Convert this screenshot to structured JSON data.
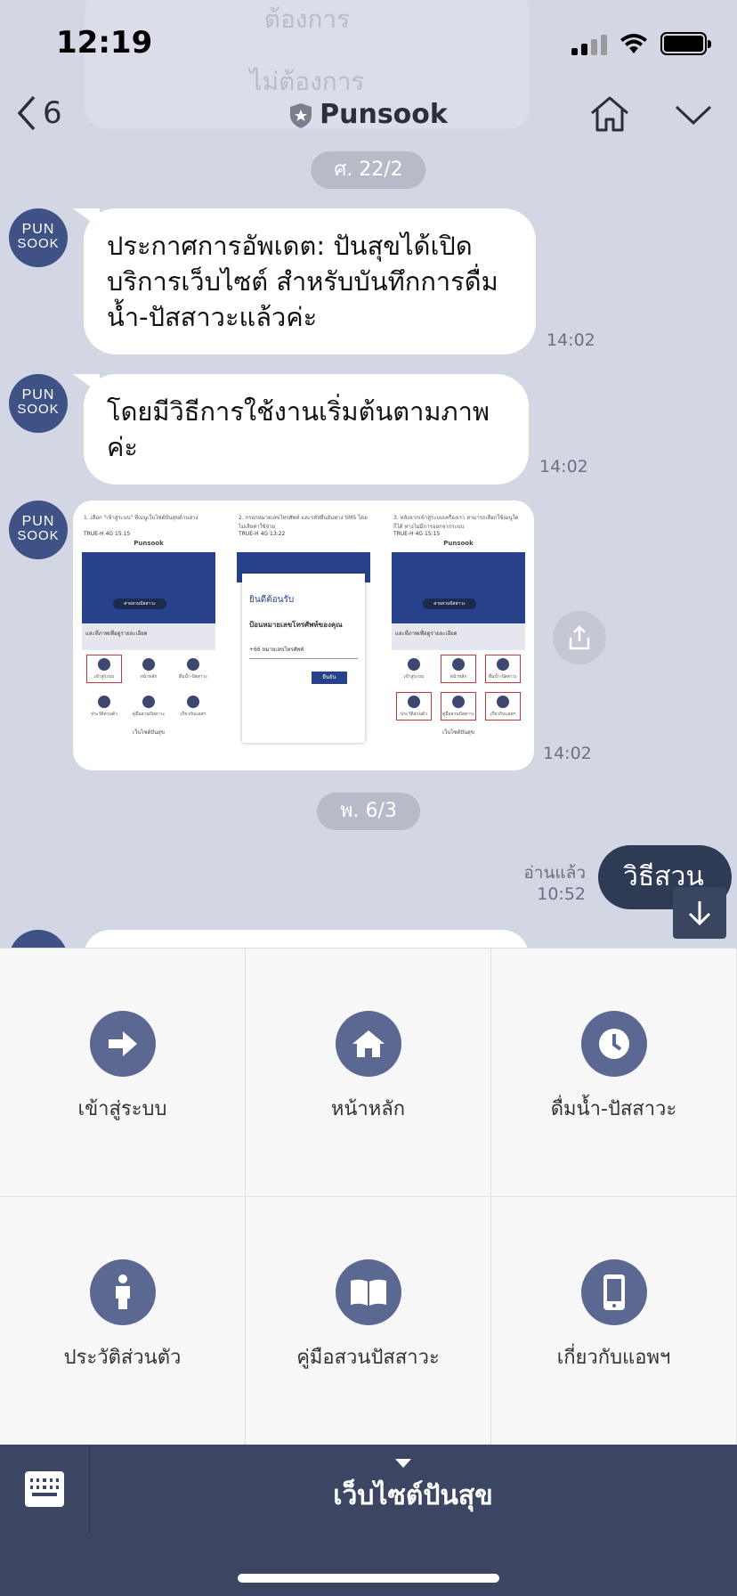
{
  "status_bar": {
    "time": "12:19"
  },
  "ghost_menu": {
    "line1": "ต้องการ",
    "line2": "ไม่ต้องการ"
  },
  "nav": {
    "back_count": "6",
    "chat_title": "Punsook"
  },
  "avatar": {
    "line1": "PUN",
    "line2": "SOOK"
  },
  "dates": {
    "first": "ศ. 22/2",
    "second": "พ. 6/3"
  },
  "messages": [
    {
      "text": "ประกาศการอัพเดต: ปันสุขได้เปิดบริการเว็บไซต์ สำหรับบันทึกการดื่มน้ำ-ปัสสาวะแล้วค่ะ",
      "time": "14:02"
    },
    {
      "text": "โดยมีวิธีการใช้งานเริ่มต้นตามภาพค่ะ",
      "time": "14:02"
    },
    {
      "time": "14:02"
    }
  ],
  "image_msg": {
    "step1": "1. เลือก \"เข้าสู่ระบบ\" ที่เมนูเว็บไซต์ปันสุขด้านล่าง",
    "step2": "2. กรอกหมายเลขโทรศัพท์ และรหัสยืนยันทาง SMS โดยไม่เสียค่าใช้จ่าย",
    "step3": "3. หลังจากเข้าสู่ระบบเครื่องเรา สามารถเลือกใช้เมนูใดก็ได้ ทางไม่มีการออกจากระบบ",
    "carrier": "TRUE-H 4G",
    "shot_time_1": "15:15",
    "shot_time_2": "13:22",
    "app_name": "Punsook",
    "banner_btn": "สายสวนปัสสาวะ",
    "tip": "และที่ภาพเพื่อดูรายละเอียด",
    "footer": "เว็บไซต์ปันสุข",
    "welcome": "ยินดีต้อนรับ",
    "phone_prompt": "ป้อนหมายเลขโทรศัพท์ของคุณ",
    "country_code": "+66",
    "phone_placeholder": "หมายเลขโทรศัพท์",
    "confirm": "ยืนยัน",
    "grid": [
      "เข้าสู่ระบบ",
      "หน้าหลัก",
      "ดื่มน้ำ-ปัสสาวะ",
      "ประวัติส่วนตัว",
      "คู่มือสวนปัสสาวะ",
      "เกี่ยวกับแอพฯ"
    ]
  },
  "outgoing": {
    "read_label": "อ่านแล้ว",
    "time": "10:52",
    "text": "วิธีสวน"
  },
  "rich_menu": {
    "items": [
      {
        "label": "เข้าสู่ระบบ",
        "icon": "arrow-right-icon"
      },
      {
        "label": "หน้าหลัก",
        "icon": "home-icon"
      },
      {
        "label": "ดื่มน้ำ-ปัสสาวะ",
        "icon": "clock-icon"
      },
      {
        "label": "ประวัติส่วนตัว",
        "icon": "info-person-icon"
      },
      {
        "label": "คู่มือสวนปัสสาวะ",
        "icon": "book-icon"
      },
      {
        "label": "เกี่ยวกับแอพฯ",
        "icon": "phone-icon"
      }
    ],
    "accent": "#5b6891"
  },
  "bottom_bar": {
    "menu_title": "เว็บไซต์ปันสุข",
    "bg": "#3c4662"
  }
}
